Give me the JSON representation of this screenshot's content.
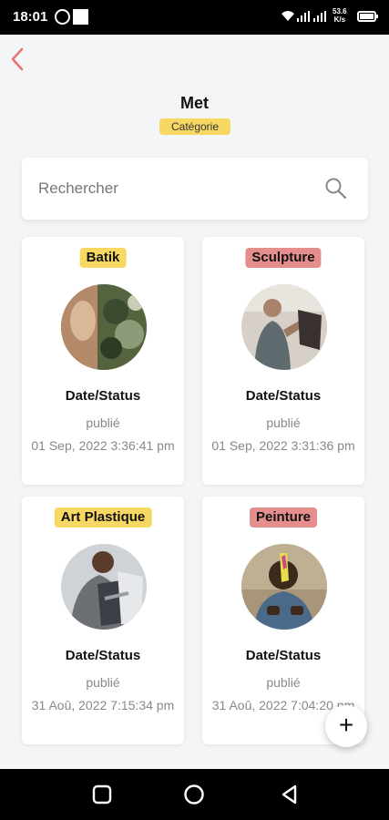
{
  "status_bar": {
    "time": "18:01",
    "speed_value": "53.6",
    "speed_unit": "K/s"
  },
  "header": {
    "title": "Met",
    "badge": "Catégorie"
  },
  "search": {
    "placeholder": "Rechercher"
  },
  "cards": [
    {
      "tag": "Batik",
      "tag_color": "#f7d863",
      "label": "Date/Status",
      "status": "publié",
      "date": "01 Sep, 2022 3:36:41 pm"
    },
    {
      "tag": "Sculpture",
      "tag_color": "#e58e8e",
      "label": "Date/Status",
      "status": "publié",
      "date": "01 Sep, 2022 3:31:36 pm"
    },
    {
      "tag": "Art Plastique",
      "tag_color": "#f7d863",
      "label": "Date/Status",
      "status": "publié",
      "date": "31 Aoû, 2022 7:15:34 pm"
    },
    {
      "tag": "Peinture",
      "tag_color": "#e58e8e",
      "label": "Date/Status",
      "status": "publié",
      "date": "31 Aoû, 2022 7:04:20 pm"
    }
  ],
  "fab": {
    "label": "+"
  },
  "icons": {
    "back": "chevron-left-icon",
    "search": "search-icon",
    "add": "plus-icon"
  },
  "colors": {
    "accent_back": "#e57373",
    "badge_yellow": "#f7d863",
    "badge_red": "#e58e8e"
  }
}
